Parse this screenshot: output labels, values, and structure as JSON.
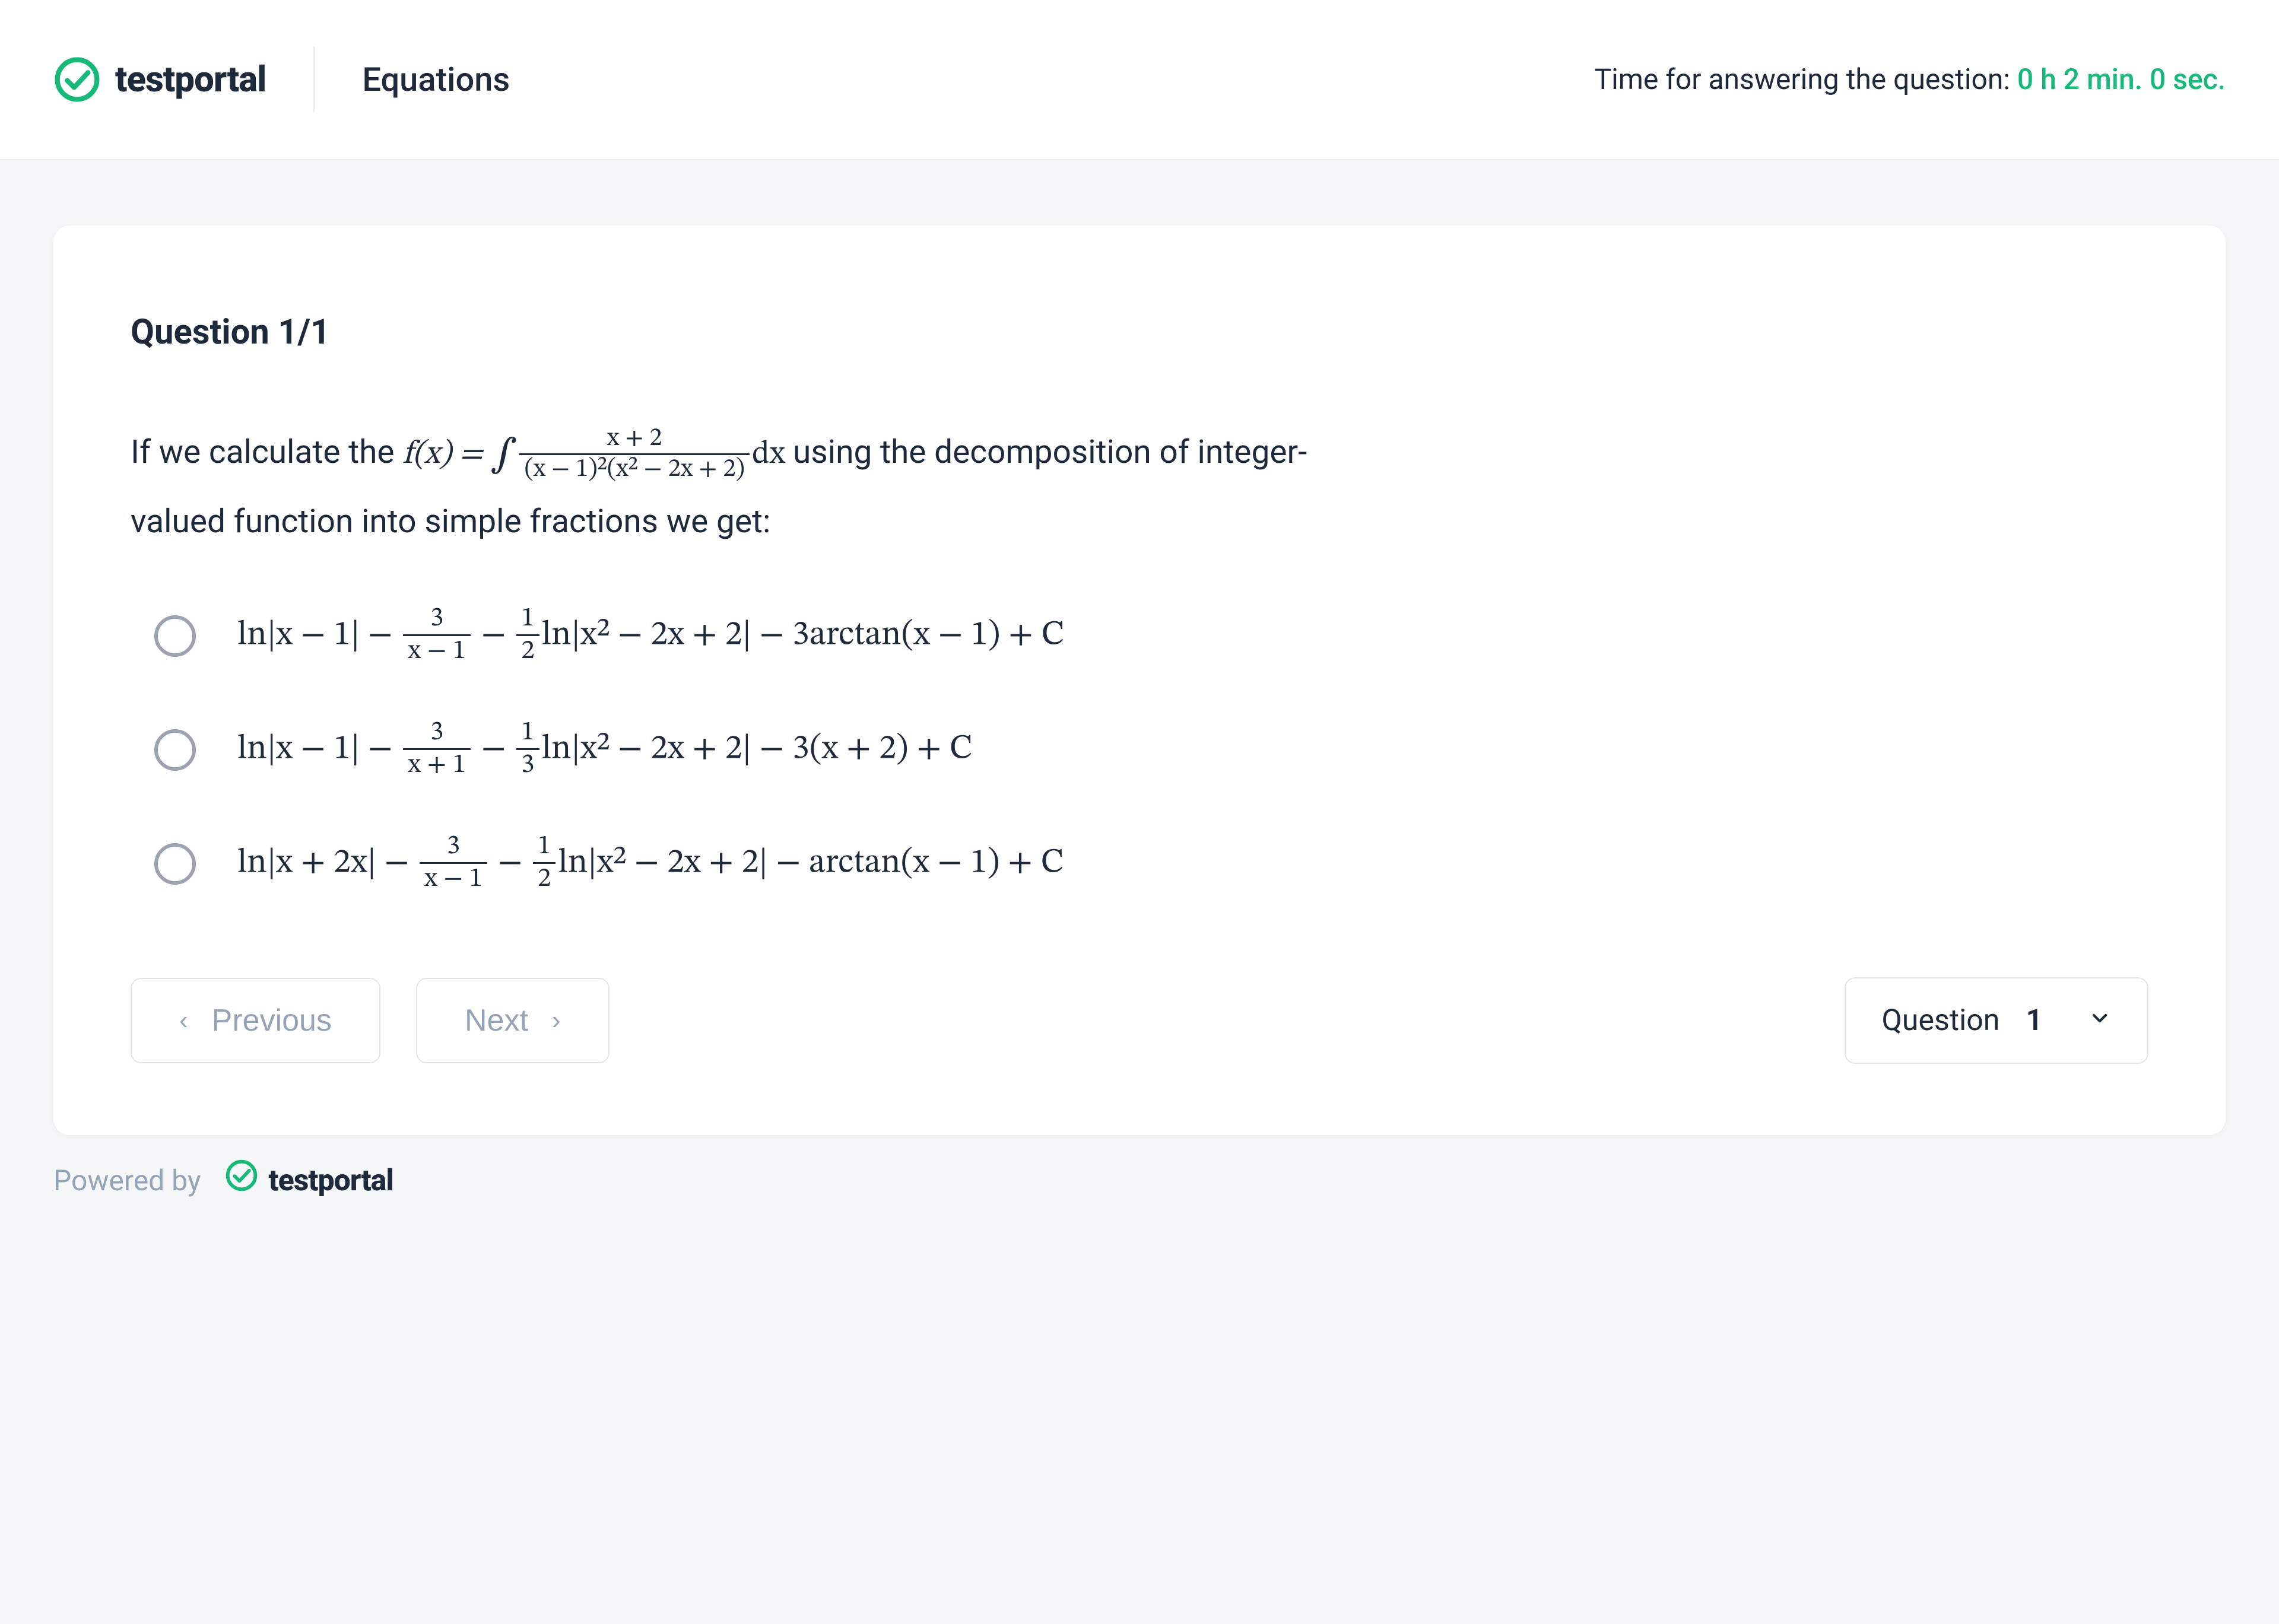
{
  "header": {
    "brand": "testportal",
    "page_title": "Equations",
    "timer_label": "Time for answering the question:",
    "timer_value": "0 h 2 min. 0 sec."
  },
  "question": {
    "counter": "Question 1/1",
    "prompt_prefix": "If we calculate the ",
    "prompt_func_lhs": "f(x) = ",
    "prompt_integrand_num": "x + 2",
    "prompt_integrand_den": "(x − 1)²(x² − 2x + 2)",
    "prompt_dx": "dx",
    "prompt_middle": " using the decomposition of integer-",
    "prompt_suffix": "valued function into simple fractions we get:"
  },
  "options": [
    {
      "pre": "ln|x − 1| − ",
      "frac1_num": "3",
      "frac1_den": "x − 1",
      "mid1": " − ",
      "frac2_num": "1",
      "frac2_den": "2",
      "mid2": "ln|x² − 2x + 2| − 3arctan(x − 1) + C"
    },
    {
      "pre": "ln|x − 1| − ",
      "frac1_num": "3",
      "frac1_den": "x + 1",
      "mid1": " − ",
      "frac2_num": "1",
      "frac2_den": "3",
      "mid2": "ln|x² − 2x + 2| − 3(x + 2) + C"
    },
    {
      "pre": "ln|x + 2x| − ",
      "frac1_num": "3",
      "frac1_den": "x − 1",
      "mid1": " − ",
      "frac2_num": "1",
      "frac2_den": "2",
      "mid2": "ln|x² − 2x + 2| − arctan(x − 1) + C"
    }
  ],
  "nav": {
    "prev_label": "Previous",
    "next_label": "Next",
    "selector_label": "Question",
    "selector_value": "1"
  },
  "footer": {
    "powered_by": "Powered by",
    "brand": "testportal"
  },
  "colors": {
    "accent": "#17b978",
    "text": "#1e293b",
    "muted": "#94a3b8",
    "border": "#e2e6eb",
    "page_bg": "#f4f6f8"
  }
}
